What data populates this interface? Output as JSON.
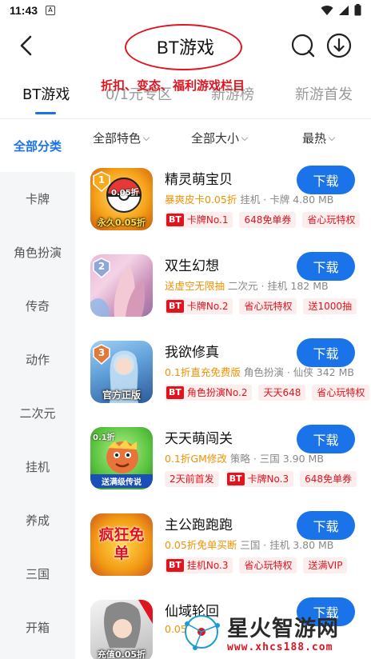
{
  "status_bar": {
    "time": "11:43"
  },
  "header": {
    "title": "BT游戏"
  },
  "annotation": "折扣、变态、福利游戏栏目",
  "tabs": [
    {
      "label": "BT游戏",
      "active": true
    },
    {
      "label": "0/1元专区",
      "active": false
    },
    {
      "label": "新游榜",
      "active": false
    },
    {
      "label": "新游首发",
      "active": false
    }
  ],
  "sidebar": {
    "items": [
      {
        "label": "全部分类",
        "active": true
      },
      {
        "label": "卡牌"
      },
      {
        "label": "角色扮演"
      },
      {
        "label": "传奇"
      },
      {
        "label": "动作"
      },
      {
        "label": "二次元"
      },
      {
        "label": "挂机"
      },
      {
        "label": "养成"
      },
      {
        "label": "三国"
      },
      {
        "label": "开箱"
      }
    ]
  },
  "filters": [
    {
      "label": "全部特色"
    },
    {
      "label": "全部大小"
    },
    {
      "label": "最热"
    }
  ],
  "download_label": "下载",
  "games": [
    {
      "name": "精灵萌宝贝",
      "highlight": "暴爽皮卡0.05折",
      "meta": "挂机 · 卡牌  4.80 MB",
      "rank": "1",
      "icon_top": "0.05折",
      "icon_caption": "永久0.05折",
      "tags": [
        {
          "bt": "BT",
          "text": "卡牌No.1"
        },
        {
          "text": "648免单券"
        },
        {
          "text": "省心玩特权"
        }
      ]
    },
    {
      "name": "双生幻想",
      "highlight": "送虚空无限抽",
      "meta": "二次元 · 挂机  182 MB",
      "rank": "2",
      "icon_caption": "",
      "tags": [
        {
          "bt": "BT",
          "text": "卡牌No.2"
        },
        {
          "text": "省心玩特权"
        },
        {
          "text": "送1000抽"
        }
      ]
    },
    {
      "name": "我欲修真",
      "highlight": "0.1折直充免费版",
      "meta": "角色扮演 · 仙侠  342 MB",
      "rank": "3",
      "icon_caption": "官方正版",
      "tags": [
        {
          "bt": "BT",
          "text": "角色扮演No.2"
        },
        {
          "text": "天天648"
        },
        {
          "text": "省心玩特权"
        }
      ]
    },
    {
      "name": "天天萌闯关",
      "highlight": "0.1折GM修改",
      "meta": "策略 · 三国  3.90 MB",
      "icon_top": "0.1折",
      "icon_caption": "送满级传说",
      "tags": [
        {
          "text": "2天前首发"
        },
        {
          "bt": "BT",
          "text": "卡牌No.3"
        },
        {
          "text": "648免单券"
        }
      ]
    },
    {
      "name": "主公跑跑跑",
      "highlight": "0.05折免单买断",
      "meta": "三国 · 挂机  3.80 MB",
      "icon_caption": "疯狂免单",
      "tags": [
        {
          "bt": "BT",
          "text": "挂机No.3"
        },
        {
          "text": "省心玩特权"
        },
        {
          "text": "送满VIP"
        }
      ]
    },
    {
      "name": "仙域轮回",
      "highlight": "0.05",
      "meta": "",
      "icon_caption": "充值0.05折",
      "tags": []
    }
  ],
  "watermark": {
    "title": "星火智游网",
    "url": "www.xhcs188.com"
  },
  "colors": {
    "accent": "#1a73e8",
    "highlight": "#f29100",
    "tag_red": "#e0141e",
    "annotation_red": "#e0141e"
  }
}
